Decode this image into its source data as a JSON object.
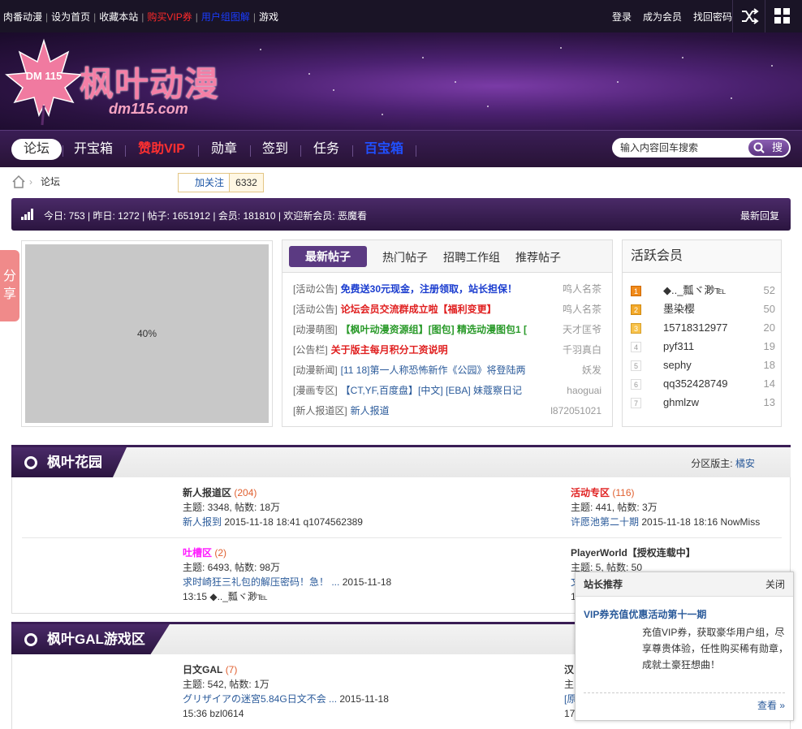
{
  "topbar": {
    "links": [
      "肉番动漫",
      "设为首页",
      "收藏本站",
      "购买VIP券",
      "用户组图解",
      "游戏"
    ],
    "right": [
      "登录",
      "成为会员",
      "找回密码"
    ]
  },
  "brand": {
    "name": "枫叶动漫",
    "url_text": "dm115.com",
    "badge": "DM 115"
  },
  "nav": {
    "tabs": [
      "论坛",
      "开宝箱",
      "赞助VIP",
      "勋章",
      "签到",
      "任务",
      "百宝箱"
    ],
    "search_placeholder": "输入内容回车搜索",
    "search_button": "搜"
  },
  "breadcrumb": {
    "current": "论坛"
  },
  "follow": {
    "label": "加关注",
    "count": "6332"
  },
  "stats": {
    "text": "今日: 753 | 昨日: 1272 | 帖子: 1651912 | 会员: 181810 | 欢迎新会员: 恶魔看",
    "latest_reply": "最新回复"
  },
  "image_placeholder": "40%",
  "posts": {
    "tabs": [
      "最新帖子",
      "热门帖子",
      "招聘工作组",
      "推荐帖子"
    ],
    "rows": [
      {
        "cat": "[活动公告]",
        "title": "免费送30元现金，注册领取，站长担保！",
        "author": "鸣人名茶"
      },
      {
        "cat": "[活动公告]",
        "title": "论坛会员交流群成立啦【福利变更】",
        "author": "鸣人名茶"
      },
      {
        "cat": "[动漫萌图]",
        "title": "【枫叶动漫资源组】[图包] 精选动漫图包1 [",
        "author": "天才匡爷"
      },
      {
        "cat": "[公告栏]",
        "title": "关于版主每月积分工资说明",
        "author": "千羽真白"
      },
      {
        "cat": "[动漫新闻]",
        "title": "[11 18]第一人称恐怖新作《公园》将登陆两",
        "author": "妖发"
      },
      {
        "cat": "[漫画专区]",
        "title": "【CT,YF,百度盘】[中文] [EBA] 妹蔻察日记",
        "author": "haoguai"
      },
      {
        "cat": "[新人报道区]",
        "title": "新人报道",
        "author": "l872051021"
      }
    ]
  },
  "members": {
    "title": "活跃会员",
    "list": [
      {
        "rank": "1",
        "name": "◆.._瓢ヾ渺℡",
        "score": "52"
      },
      {
        "rank": "2",
        "name": "墨染樱",
        "score": "50"
      },
      {
        "rank": "3",
        "name": "15718312977",
        "score": "20"
      },
      {
        "rank": "4",
        "name": "pyf311",
        "score": "19"
      },
      {
        "rank": "5",
        "name": "sephy",
        "score": "18"
      },
      {
        "rank": "6",
        "name": "qq352428749",
        "score": "14"
      },
      {
        "rank": "7",
        "name": "ghmlzw",
        "score": "13"
      }
    ]
  },
  "section1": {
    "title": "枫叶花园",
    "moderator_label": "分区版主:",
    "moderator": "橘安",
    "forums": [
      {
        "name": "新人报道区",
        "count": "(204)",
        "stats": "主题: 3348, 帖数: 18万",
        "last": "新人报到",
        "time": "2015-11-18 18:41 q1074562389"
      },
      {
        "name": "活动专区",
        "count": "(116)",
        "stats": "主题: 441, 帖数: 3万",
        "last": "许愿池第二十期",
        "time": "2015-11-18 18:16 NowMiss"
      },
      {
        "name": "吐槽区",
        "count": "(2)",
        "stats": "主题: 6493, 帖数: 98万",
        "last": "求时崎狂三礼包的解压密码！急！ ...",
        "time": "2015-11-18",
        "time2": "13:15 ◆.._瓢ヾ渺℡"
      },
      {
        "name": "PlayerWorld【授权连载中】",
        "stats": "主题: 5, 帖数: 50",
        "last": "文",
        "time2": "1"
      }
    ]
  },
  "section2": {
    "title": "枫叶GAL游戏区",
    "forums": [
      {
        "name": "日文GAL",
        "count": "(7)",
        "stats": "主题: 542, 帖数: 1万",
        "last": "グリザイアの迷宮5.84G日文不会 ...",
        "time": "2015-11-18",
        "time2": "15:36 bzl0614"
      },
      {
        "name": "汉",
        "stats": "主",
        "last": "[原",
        "time2": "17"
      }
    ]
  },
  "popup": {
    "header": "站长推荐",
    "close": "关闭",
    "title": "VIP券充值优惠活动第十一期",
    "desc": "充值VIP券，获取豪华用户组，尽享尊贵体验，任性购买稀有勋章，成就土豪狂想曲！",
    "more": "查看 »"
  },
  "share": "分享"
}
